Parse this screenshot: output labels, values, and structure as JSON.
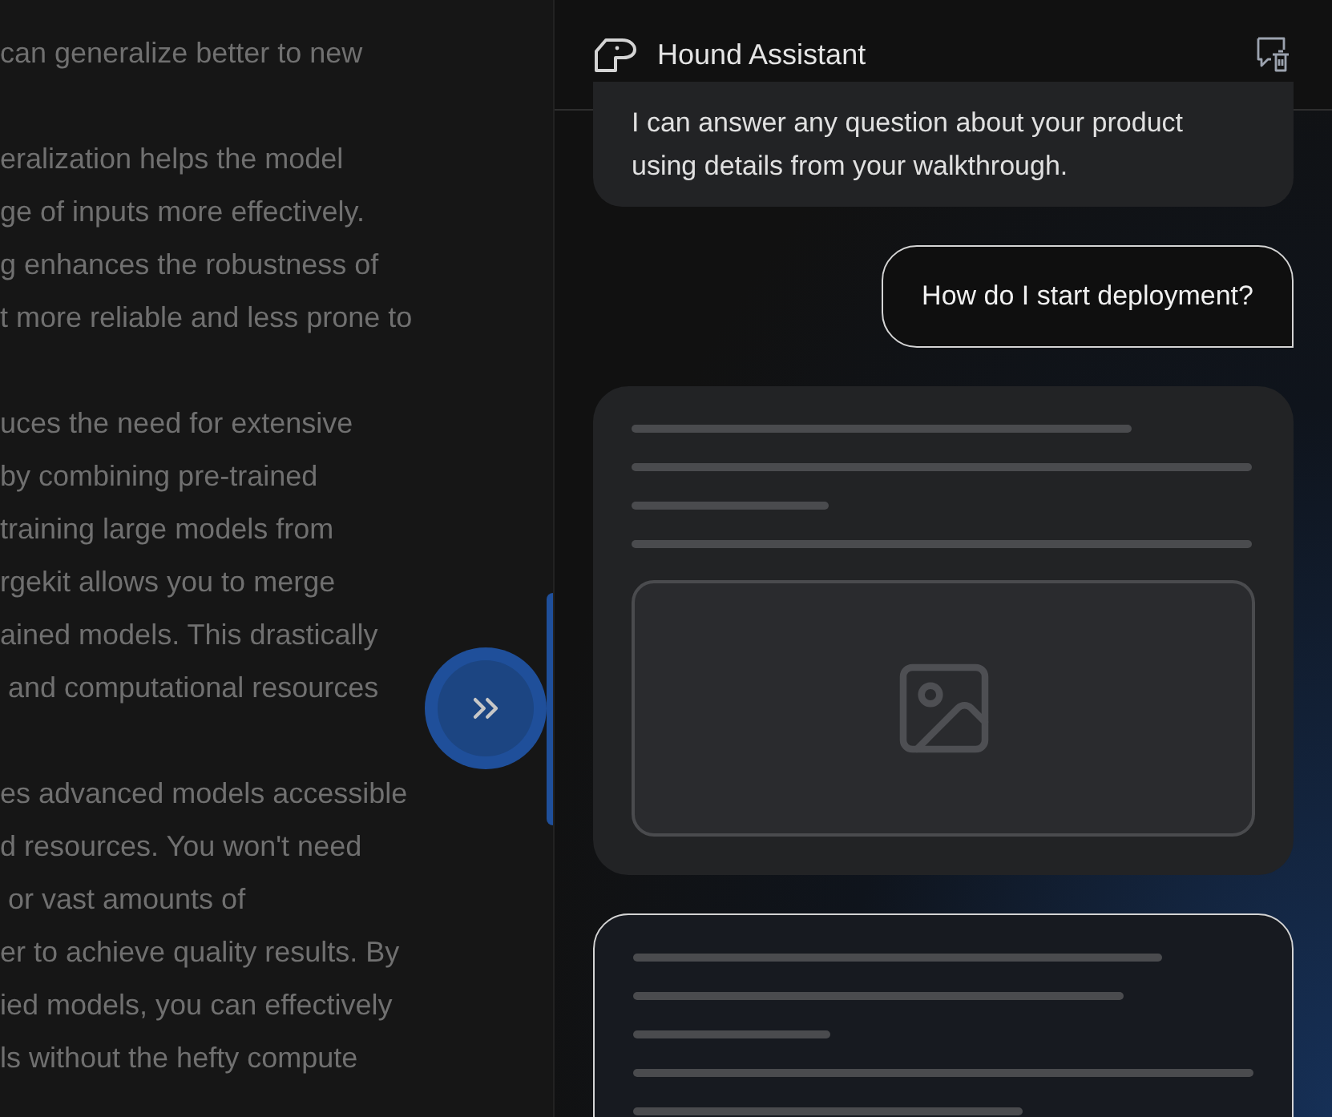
{
  "article": {
    "paragraphs": [
      {
        "lines": [
          "can generalize better to new"
        ]
      },
      {
        "lines": [
          "eralization helps the model",
          "ge of inputs more effectively.",
          "g enhances the robustness of",
          "t more reliable and less prone to"
        ]
      },
      {
        "lines": [
          "uces the need for extensive",
          "by combining pre-trained",
          "training large models from",
          "rgekit allows you to merge",
          "ained models. This drastically",
          " and computational resources"
        ]
      },
      {
        "lines": [
          "es advanced models accessible",
          "d resources. You won't need",
          " or vast amounts of",
          "er to achieve quality results. By",
          "ied models, you can effectively",
          "ls without the hefty compute"
        ]
      }
    ]
  },
  "panel_toggle": {
    "expanded": true
  },
  "assistant": {
    "title": "Hound Assistant",
    "messages": [
      {
        "kind": "assistant",
        "text": "I can answer any question about your product using details from your walkthrough."
      },
      {
        "kind": "user",
        "text": "How do I start deployment?"
      },
      {
        "kind": "loading_image",
        "highlighted": false
      },
      {
        "kind": "loading",
        "highlighted": true
      }
    ]
  }
}
